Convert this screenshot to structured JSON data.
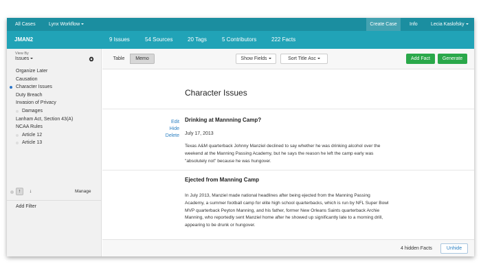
{
  "topnav": {
    "all_cases": "All Cases",
    "workflow": "Lynx Workflow",
    "create_case": "Create Case",
    "info": "Info",
    "user": "Lecia Kaslofsky"
  },
  "stats": {
    "case_id": "JMAN2",
    "issues": "9 Issues",
    "sources": "54 Sources",
    "tags": "20 Tags",
    "contributors": "5 Contributors",
    "facts": "222 Facts"
  },
  "sidebar": {
    "view_by_label": "View By",
    "view_by_value": "Issues",
    "items": [
      {
        "label": "Organize Later",
        "sub": false,
        "active": false
      },
      {
        "label": "Causation",
        "sub": false,
        "active": false
      },
      {
        "label": "Character Issues",
        "sub": false,
        "active": true
      },
      {
        "label": "Duty Breach",
        "sub": false,
        "active": false
      },
      {
        "label": "Invasion of Privacy",
        "sub": false,
        "active": false
      },
      {
        "label": "Damages",
        "sub": true,
        "active": false
      },
      {
        "label": "Lanham Act, Section 43(A)",
        "sub": false,
        "active": false
      },
      {
        "label": "NCAA Rules",
        "sub": false,
        "active": false
      },
      {
        "label": "Article 12",
        "sub": true,
        "active": false
      },
      {
        "label": "Article 13",
        "sub": true,
        "active": false
      }
    ],
    "up_arrow": "↑",
    "down_arrow": "↓",
    "manage": "Manage",
    "add_filter": "Add Filter"
  },
  "toolbar": {
    "table": "Table",
    "memo": "Memo",
    "show_fields": "Show Fields",
    "sort": "Sort Title Asc",
    "add_fact": "Add Fact",
    "generate": "Generate"
  },
  "memo": {
    "title": "Character Issues",
    "facts": [
      {
        "actions": [
          "Edit",
          "Hide",
          "Delete"
        ],
        "title": "Drinking at Mannning Camp?",
        "date": "July 17, 2013",
        "body": "Texas A&M quarterback Johnny Manziel declined to say whether he was drinking alcohol over the weekend at the Manning Passing Academy, but he says the reason he left the camp early was \"absolutely not\" because he was hungover."
      },
      {
        "title": "Ejected from Manning Camp",
        "body": " In July 2013, Manziel made national headlines after being ejected from the Manning Passing Academy, a summer football camp for elite high school quarterbacks, which is run by NFL Super Bowl MVP quarterback Peyton Manning, and his father, former New Orleans Saints quarterback Archie Manning, who reportedly sent Manziel home after he showed up significantly late to a morning drill, appearing to be drunk or hungover."
      }
    ]
  },
  "footer": {
    "hidden_facts": "4 hidden Facts",
    "unhide": "Unhide"
  },
  "colors": {
    "topnav": "#1b8ea0",
    "statsbar": "#21a3b7",
    "green": "#2aa84a",
    "link": "#2a7fc1",
    "active_dot": "#2a74c9"
  }
}
